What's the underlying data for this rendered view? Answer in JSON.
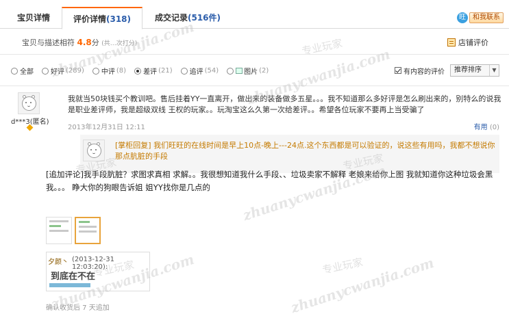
{
  "tabs": [
    {
      "label": "宝贝详情",
      "count": ""
    },
    {
      "label": "评价详情",
      "count": "(318)"
    },
    {
      "label": "成交记录",
      "count": "(516件)"
    }
  ],
  "contact": {
    "label": "和我联系"
  },
  "score": {
    "prefix": "宝贝与描述相符",
    "value": "4.8",
    "unit": "分",
    "note": "(共…次打分)"
  },
  "shop_eval": {
    "label": "店铺评价"
  },
  "filters": [
    {
      "label": "全部",
      "count": "",
      "selected": false
    },
    {
      "label": "好评",
      "count": "(289)",
      "selected": false
    },
    {
      "label": "中评",
      "count": "(8)",
      "selected": false
    },
    {
      "label": "差评",
      "count": "(21)",
      "selected": true
    },
    {
      "label": "追评",
      "count": "(54)",
      "selected": false
    },
    {
      "label": "图片",
      "count": "(2)",
      "selected": false
    }
  ],
  "has_content": {
    "label": "有内容的评价",
    "checked": true
  },
  "sort": {
    "value": "推荐排序"
  },
  "review": {
    "user": "d***3(匿名)",
    "text": "我就当50块钱买个教训吧。售后挂着YY一直离开，做出来的装备做多五星。。。我不知道那么多好评是怎么刷出来的，别特么的说我是职业差评师，我是超级双线 王权的玩家。。玩淘宝这么久第一次给差评。。希望各位玩家不要再上当受骗了",
    "date": "2013年12月31日 12:11",
    "useful_label": "有用",
    "useful_count": "(0)",
    "reply": "[掌柜回复] 我们旺旺的在线时间是早上10点-晚上---24点.这个东西都是可以验证的，说这些有用吗，我都不想说你那点肮脏的手段",
    "followup": "[追加评论]我手段肮脏？求图求真相 求解。。我很想知道我什么手段、、垃圾卖家不解释 老娘来给你上图 我就知道你这种垃圾会黑我。。。 睁大你的狗眼告诉姐 姐YY找你是几点的",
    "preview": {
      "who": "夕颜丶",
      "time": "(2013-12-31 12:03:20):",
      "big": "到底在不在"
    },
    "confirm": "确认收货后 7 天追加"
  },
  "watermark": {
    "cn": "专业玩家",
    "en": "zhuanycwanjia.com"
  },
  "colors": {
    "accent": "#ff6600",
    "link": "#2a5caa",
    "reply": "#c47a00"
  }
}
